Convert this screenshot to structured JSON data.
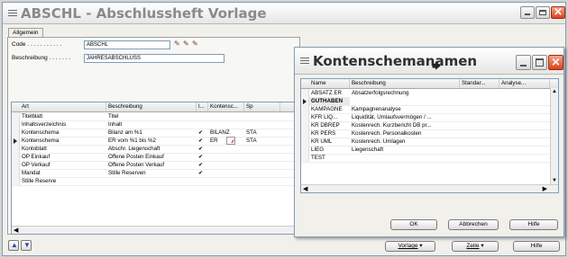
{
  "main_window": {
    "title": "ABSCHL - Abschlussheft Vorlage",
    "tab": "Allgemein",
    "fields": [
      {
        "label": "Code . . . . . . . . . . .",
        "value": "ABSCHL"
      },
      {
        "label": "Beschreibung . . . . . . .",
        "value": "JAHRESABSCHLUSS"
      }
    ],
    "columns": [
      "Art",
      "Beschreibung",
      "I...",
      "Kontensc...",
      "Sp"
    ],
    "rows": [
      {
        "art": "Titelblatt",
        "beschreibung": "Titel",
        "i": "",
        "konten": "",
        "sp": ""
      },
      {
        "art": "Inhaltsverzeichnis",
        "beschreibung": "Inhalt",
        "i": "",
        "konten": "",
        "sp": ""
      },
      {
        "art": "Kontenschema",
        "beschreibung": "Bilanz am %1",
        "i": "✔",
        "konten": "BILANZ",
        "sp": "STA"
      },
      {
        "art": "Kontenschema",
        "beschreibung": "ER vom %1 bis %2",
        "i": "✔",
        "konten": "ER",
        "sp": "STA"
      },
      {
        "art": "Kontoblatt",
        "beschreibung": "Abschr. Liegenschaft",
        "i": "✔",
        "konten": "",
        "sp": ""
      },
      {
        "art": "OP Einkauf",
        "beschreibung": "Offene Posten Einkauf",
        "i": "✔",
        "konten": "",
        "sp": ""
      },
      {
        "art": "OP Verkauf",
        "beschreibung": "Offene Posten Verkauf",
        "i": "✔",
        "konten": "",
        "sp": ""
      },
      {
        "art": "Mandat",
        "beschreibung": "Stille Reserven",
        "i": "✔",
        "konten": "",
        "sp": ""
      },
      {
        "art": "Stille Reserve",
        "beschreibung": "",
        "i": "",
        "konten": "",
        "sp": ""
      }
    ],
    "buttons": {
      "vorlage": "Vorlage",
      "zeile": "Zeile",
      "hilfe": "Hilfe"
    }
  },
  "lookup_window": {
    "title": "Kontenschemanamen",
    "columns": [
      "Name",
      "Beschreibung",
      "Standar...",
      "Analyse..."
    ],
    "rows": [
      {
        "name": "ABSATZ ER",
        "beschreibung": "Absatzerfolgsrechnung"
      },
      {
        "name": "GUTHABEN",
        "beschreibung": ""
      },
      {
        "name": "KAMPAGNE",
        "beschreibung": "Kampagnenanalyse"
      },
      {
        "name": "KFR LIQ...",
        "beschreibung": "Liquidität, Umlaufsvermögen / ..."
      },
      {
        "name": "KR DBREP",
        "beschreibung": "Kostenrech. Kurzbericht DB pr..."
      },
      {
        "name": "KR PERS",
        "beschreibung": "Kostenrech. Personalkosten"
      },
      {
        "name": "KR UML",
        "beschreibung": "Kostenrech. Umlagen"
      },
      {
        "name": "LIEG",
        "beschreibung": "Liegenschaft"
      },
      {
        "name": "TEST",
        "beschreibung": ""
      }
    ],
    "buttons": {
      "ok": "OK",
      "abbrechen": "Abbrechen",
      "hilfe": "Hilfe"
    }
  }
}
